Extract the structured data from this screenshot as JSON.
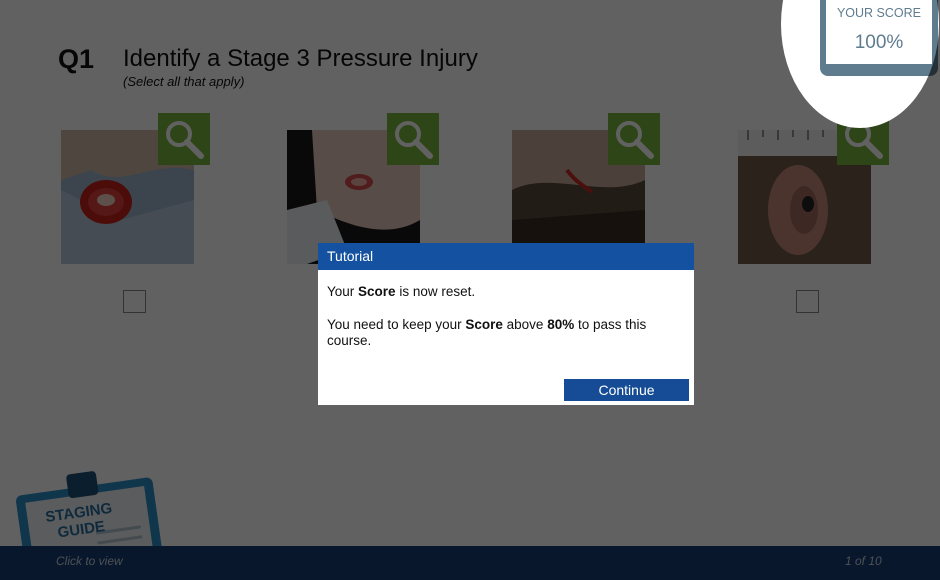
{
  "question": {
    "number": "Q1",
    "title": "Identify a Stage 3 Pressure Injury",
    "subtitle": "(Select all that apply)"
  },
  "score": {
    "label": "YOUR SCORE",
    "value": "100%"
  },
  "options": [
    {
      "image": "wound-photo-1",
      "zoom_icon": "magnifier-icon",
      "checked": false
    },
    {
      "image": "wound-photo-2",
      "zoom_icon": "magnifier-icon",
      "checked": false
    },
    {
      "image": "wound-photo-3",
      "zoom_icon": "magnifier-icon",
      "checked": false
    },
    {
      "image": "wound-photo-4",
      "zoom_icon": "magnifier-icon",
      "checked": false
    }
  ],
  "staging_guide": {
    "line1": "STAGING",
    "line2": "GUIDE",
    "hint": "Click to view"
  },
  "pagination": "1 of 10",
  "dialog": {
    "title": "Tutorial",
    "line1_pre": "Your ",
    "line1_bold": "Score",
    "line1_post": " is now reset.",
    "line2_pre": "You need to keep your ",
    "line2_bold1": "Score",
    "line2_mid": " above ",
    "line2_bold2": "80%",
    "line2_post": " to pass this course.",
    "button": "Continue"
  },
  "colors": {
    "accent_green": "#7ab540",
    "dialog_header": "#1451a0",
    "button": "#154c95",
    "bottom_bar": "#1a3d73",
    "score_frame": "#5f7c8f"
  }
}
